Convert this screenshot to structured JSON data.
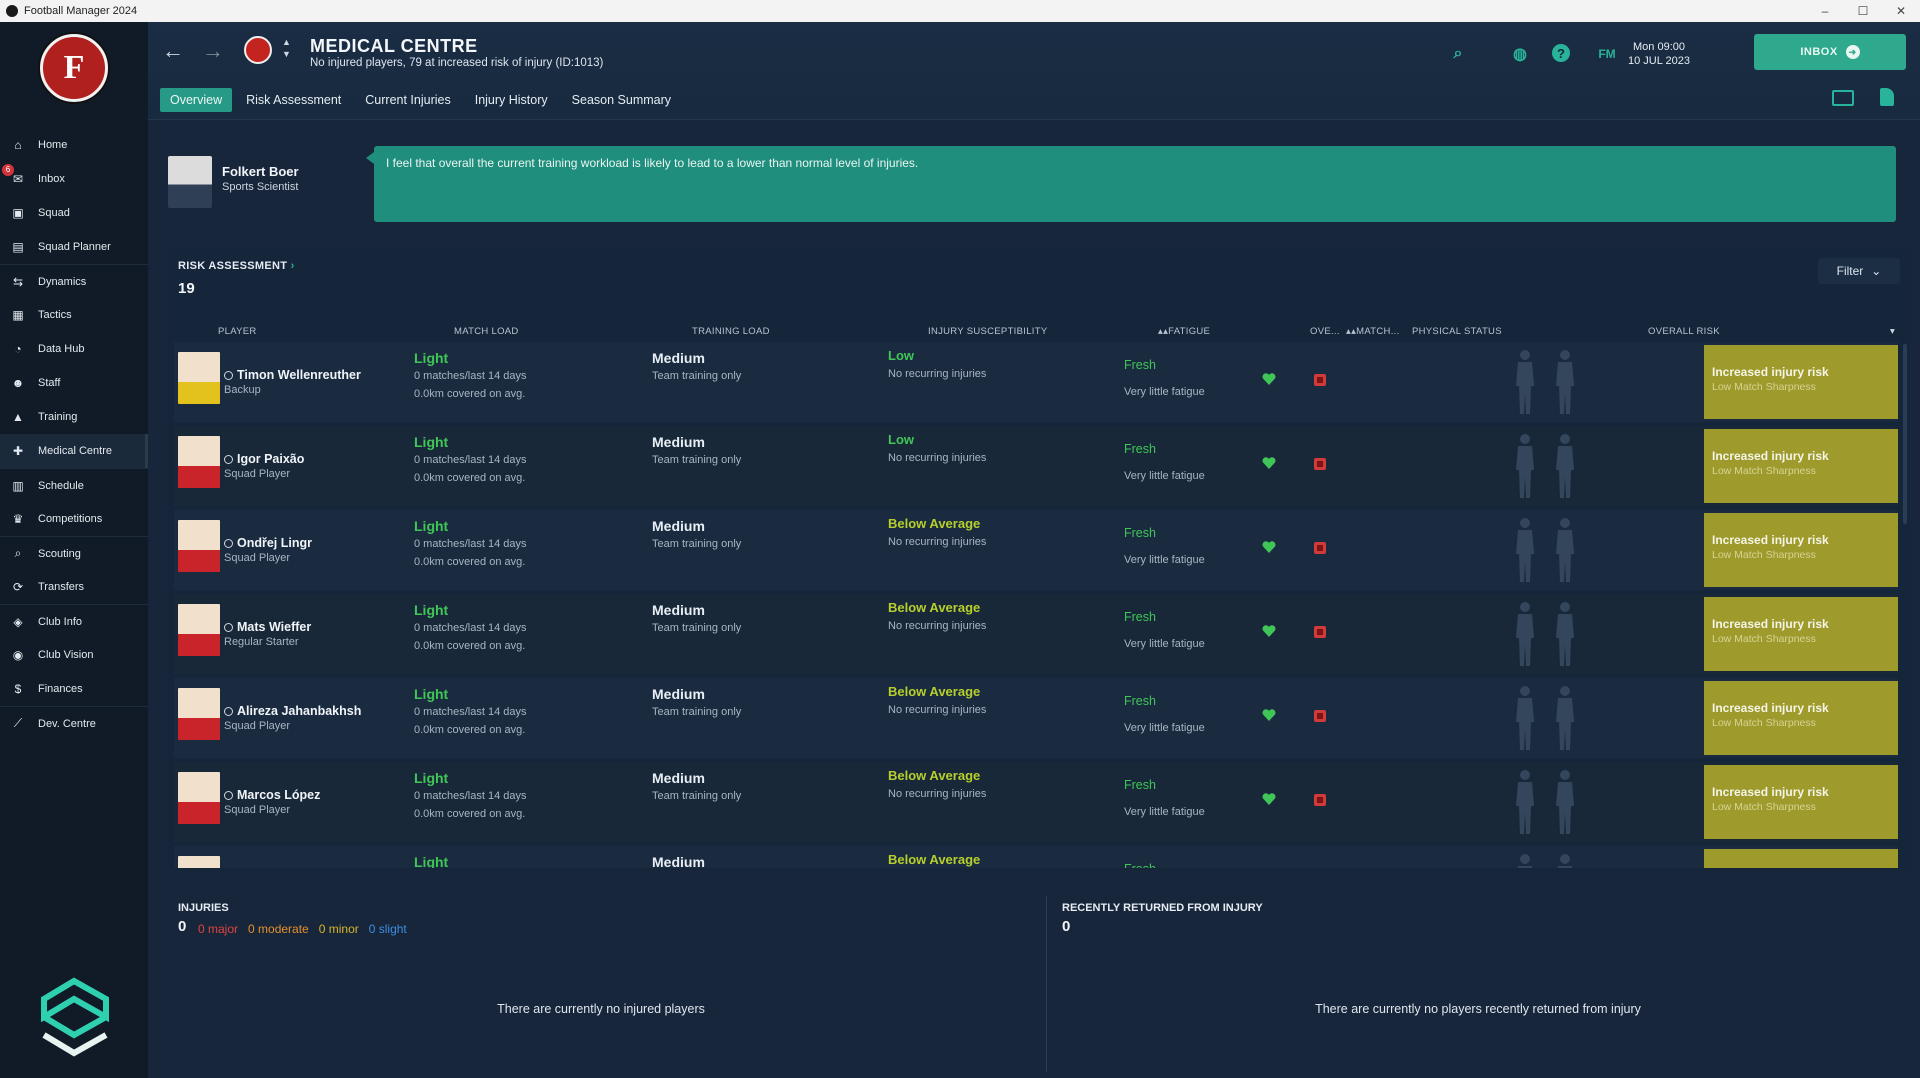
{
  "window": {
    "title": "Football Manager 2024"
  },
  "sidebar": {
    "crest_letter": "F",
    "items": [
      {
        "label": "Home",
        "icon": "home-icon",
        "glyph": "⌂"
      },
      {
        "label": "Inbox",
        "icon": "inbox-icon",
        "glyph": "✉",
        "badge": "6"
      },
      {
        "label": "Squad",
        "icon": "shirt-icon",
        "glyph": "▣"
      },
      {
        "label": "Squad Planner",
        "icon": "clipboard-icon",
        "glyph": "▤"
      },
      {
        "label": "Dynamics",
        "icon": "dynamics-icon",
        "glyph": "⇆"
      },
      {
        "label": "Tactics",
        "icon": "tactics-icon",
        "glyph": "▦"
      },
      {
        "label": "Data Hub",
        "icon": "data-hub-icon",
        "glyph": "◔"
      },
      {
        "label": "Staff",
        "icon": "staff-icon",
        "glyph": "☻"
      },
      {
        "label": "Training",
        "icon": "training-icon",
        "glyph": "▲"
      },
      {
        "label": "Medical Centre",
        "icon": "medical-icon",
        "glyph": "✚",
        "active": true
      },
      {
        "label": "Schedule",
        "icon": "calendar-icon",
        "glyph": "▥"
      },
      {
        "label": "Competitions",
        "icon": "trophy-icon",
        "glyph": "♛"
      },
      {
        "label": "Scouting",
        "icon": "scouting-icon",
        "glyph": "⌕"
      },
      {
        "label": "Transfers",
        "icon": "transfers-icon",
        "glyph": "⟳"
      },
      {
        "label": "Club Info",
        "icon": "shield-icon",
        "glyph": "◈"
      },
      {
        "label": "Club Vision",
        "icon": "vision-icon",
        "glyph": "◉"
      },
      {
        "label": "Finances",
        "icon": "finances-icon",
        "glyph": "$"
      },
      {
        "label": "Dev. Centre",
        "icon": "dev-centre-icon",
        "glyph": "⟋"
      }
    ]
  },
  "header": {
    "title": "MEDICAL CENTRE",
    "subtitle": "No injured players, 79 at increased risk of injury (ID:1013)",
    "tabs": [
      "Overview",
      "Risk Assessment",
      "Current Injuries",
      "Injury History",
      "Season Summary"
    ],
    "active_tab": "Overview",
    "fm_label": "FM",
    "date_line1": "Mon 09:00",
    "date_line2": "10 JUL 2023",
    "inbox_label": "INBOX"
  },
  "advice": {
    "name": "Folkert Boer",
    "role": "Sports Scientist",
    "message": "I feel that overall the current training workload is likely to lead to a lower than normal level of injuries."
  },
  "risk_assessment": {
    "title": "RISK ASSESSMENT",
    "count": "19",
    "filter_label": "Filter",
    "columns": {
      "player": "PLAYER",
      "match_load": "MATCH LOAD",
      "training_load": "TRAINING LOAD",
      "injury_susceptibility": "INJURY SUSCEPTIBILITY",
      "fatigue": "FATIGUE",
      "overall": "OVE...",
      "match": "MATCH...",
      "physical_status": "PHYSICAL STATUS",
      "overall_risk": "OVERALL RISK"
    },
    "rows": [
      {
        "name": "Timon Wellenreuther",
        "role": "Backup",
        "gk": true,
        "match_load": "Light",
        "matches": "0 matches/last 14 days",
        "km": "0.0km covered on avg.",
        "training_load": "Medium",
        "training_sub": "Team training only",
        "susceptibility": "Low",
        "susceptibility_sub": "No recurring injuries",
        "fatigue": "Fresh",
        "fatigue_sub": "Very little fatigue",
        "risk": "Increased injury risk",
        "risk_sub": "Low Match Sharpness"
      },
      {
        "name": "Igor Paixão",
        "role": "Squad Player",
        "match_load": "Light",
        "matches": "0 matches/last 14 days",
        "km": "0.0km covered on avg.",
        "training_load": "Medium",
        "training_sub": "Team training only",
        "susceptibility": "Low",
        "susceptibility_sub": "No recurring injuries",
        "fatigue": "Fresh",
        "fatigue_sub": "Very little fatigue",
        "risk": "Increased injury risk",
        "risk_sub": "Low Match Sharpness"
      },
      {
        "name": "Ondřej Lingr",
        "role": "Squad Player",
        "match_load": "Light",
        "matches": "0 matches/last 14 days",
        "km": "0.0km covered on avg.",
        "training_load": "Medium",
        "training_sub": "Team training only",
        "susceptibility": "Below Average",
        "susceptibility_sub": "No recurring injuries",
        "fatigue": "Fresh",
        "fatigue_sub": "Very little fatigue",
        "risk": "Increased injury risk",
        "risk_sub": "Low Match Sharpness"
      },
      {
        "name": "Mats Wieffer",
        "role": "Regular Starter",
        "match_load": "Light",
        "matches": "0 matches/last 14 days",
        "km": "0.0km covered on avg.",
        "training_load": "Medium",
        "training_sub": "Team training only",
        "susceptibility": "Below Average",
        "susceptibility_sub": "No recurring injuries",
        "fatigue": "Fresh",
        "fatigue_sub": "Very little fatigue",
        "risk": "Increased injury risk",
        "risk_sub": "Low Match Sharpness"
      },
      {
        "name": "Alireza Jahanbakhsh",
        "role": "Squad Player",
        "match_load": "Light",
        "matches": "0 matches/last 14 days",
        "km": "0.0km covered on avg.",
        "training_load": "Medium",
        "training_sub": "Team training only",
        "susceptibility": "Below Average",
        "susceptibility_sub": "No recurring injuries",
        "fatigue": "Fresh",
        "fatigue_sub": "Very little fatigue",
        "risk": "Increased injury risk",
        "risk_sub": "Low Match Sharpness"
      },
      {
        "name": "Marcos López",
        "role": "Squad Player",
        "match_load": "Light",
        "matches": "0 matches/last 14 days",
        "km": "0.0km covered on avg.",
        "training_load": "Medium",
        "training_sub": "Team training only",
        "susceptibility": "Below Average",
        "susceptibility_sub": "No recurring injuries",
        "fatigue": "Fresh",
        "fatigue_sub": "Very little fatigue",
        "risk": "Increased injury risk",
        "risk_sub": "Low Match Sharpness"
      },
      {
        "name": "",
        "role": "",
        "match_load": "Light",
        "matches": "",
        "km": "",
        "training_load": "Medium",
        "training_sub": "",
        "susceptibility": "Below Average",
        "susceptibility_sub": "",
        "fatigue": "Fresh",
        "fatigue_sub": "",
        "risk": "",
        "risk_sub": ""
      }
    ]
  },
  "colors": {
    "low": "#40c657",
    "below_average": "#b6cf2c",
    "risk": "#9e9a2c",
    "accent": "#2fa98d"
  },
  "injuries": {
    "title": "INJURIES",
    "count": "0",
    "major": "0 major",
    "moderate": "0 moderate",
    "minor": "0 minor",
    "slight": "0 slight",
    "empty": "There are currently no injured players"
  },
  "returned": {
    "title": "RECENTLY RETURNED FROM INJURY",
    "count": "0",
    "empty": "There are currently no players recently returned from injury"
  }
}
